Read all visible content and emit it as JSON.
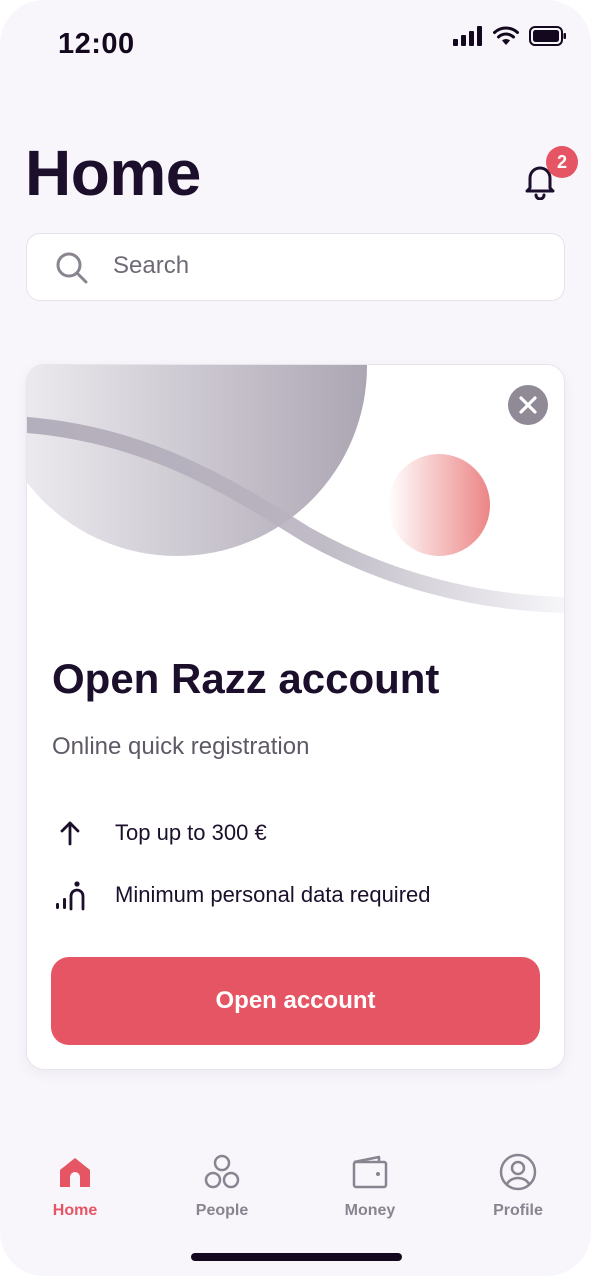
{
  "status_bar": {
    "time": "12:00"
  },
  "header": {
    "title": "Home",
    "notification_count": "2"
  },
  "search": {
    "placeholder": "Search",
    "value": ""
  },
  "promo": {
    "title": "Open Razz account",
    "subtitle": "Online quick registration",
    "features": [
      {
        "icon": "arrow-up-icon",
        "text": "Top up to 300 €"
      },
      {
        "icon": "person-signal-icon",
        "text": "Minimum personal data required"
      }
    ],
    "cta_label": "Open account",
    "close_icon": "close-icon"
  },
  "nav": {
    "items": [
      {
        "label": "Home",
        "icon": "home-icon",
        "active": true
      },
      {
        "label": "People",
        "icon": "people-icon",
        "active": false
      },
      {
        "label": "Money",
        "icon": "wallet-icon",
        "active": false
      },
      {
        "label": "Profile",
        "icon": "profile-icon",
        "active": false
      }
    ]
  },
  "colors": {
    "accent": "#e65563",
    "text": "#1b0f2c",
    "background": "#f8f6fb",
    "muted": "#8a8490"
  }
}
